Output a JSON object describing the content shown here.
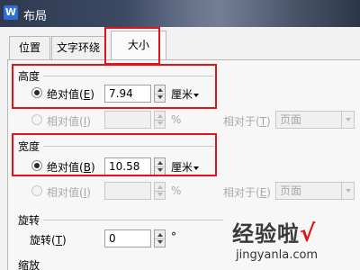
{
  "window": {
    "app_icon_letter": "W",
    "title": "布局"
  },
  "tabs": [
    {
      "label": "位置"
    },
    {
      "label": "文字环绕"
    },
    {
      "label": "大小"
    }
  ],
  "height": {
    "section": "高度",
    "absolute": {
      "label": "绝对值",
      "key": "E",
      "value": "7.94",
      "unit": "厘米"
    },
    "relative": {
      "label": "相对值",
      "key": "I",
      "value": "",
      "percent": "%"
    },
    "relative_to": {
      "label": "相对于",
      "key": "T",
      "value": "页面"
    }
  },
  "width": {
    "section": "宽度",
    "absolute": {
      "label": "绝对值",
      "key": "B",
      "value": "10.58",
      "unit": "厘米"
    },
    "relative": {
      "label": "相对值",
      "key": "I",
      "value": "",
      "percent": "%"
    },
    "relative_to": {
      "label": "相对于",
      "key": "E",
      "value": "页面"
    }
  },
  "rotation": {
    "section": "旋转",
    "label": "旋转",
    "key": "T",
    "value": "0",
    "unit": "°"
  },
  "scale": {
    "section": "缩放"
  },
  "watermark": {
    "text": "经验啦",
    "check": "√",
    "url": "jingyanla.com"
  },
  "colors": {
    "highlight": "#e2131a",
    "app_icon": "#2d6fd4"
  }
}
